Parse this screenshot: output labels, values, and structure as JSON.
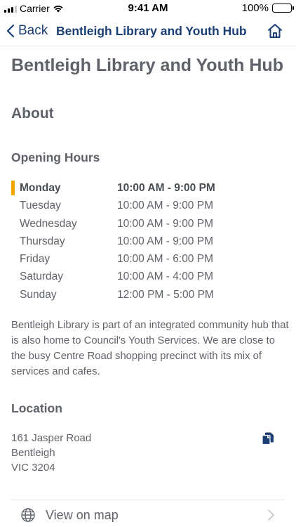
{
  "status_bar": {
    "carrier": "Carrier",
    "time": "9:41 AM",
    "battery": "100%"
  },
  "nav": {
    "back_label": "Back",
    "title": "Bentleigh Library and Youth Hub",
    "back_icon": "chevron-left-icon",
    "home_icon": "home-icon"
  },
  "page": {
    "title": "Bentleigh Library and Youth Hub"
  },
  "about": {
    "heading": "About",
    "opening_hours_heading": "Opening Hours",
    "hours": [
      {
        "day": "Monday",
        "time": "10:00 AM - 9:00 PM",
        "today": true
      },
      {
        "day": "Tuesday",
        "time": "10:00 AM - 9:00 PM",
        "today": false
      },
      {
        "day": "Wednesday",
        "time": "10:00 AM - 9:00 PM",
        "today": false
      },
      {
        "day": "Thursday",
        "time": "10:00 AM - 9:00 PM",
        "today": false
      },
      {
        "day": "Friday",
        "time": "10:00 AM - 6:00 PM",
        "today": false
      },
      {
        "day": "Saturday",
        "time": "10:00 AM - 4:00 PM",
        "today": false
      },
      {
        "day": "Sunday",
        "time": "12:00 PM - 5:00 PM",
        "today": false
      }
    ],
    "description": "Bentleigh Library is part of an integrated community hub that is also home to Council's Youth Services. We are close to the busy Centre Road shopping precinct with its mix of services and cafes."
  },
  "location": {
    "heading": "Location",
    "address_line1": "161 Jasper Road",
    "address_line2": "Bentleigh",
    "address_line3": "VIC 3204",
    "copy_icon": "copy-icon",
    "map_link_label": "View on map",
    "map_icon": "globe-icon",
    "chevron_icon": "chevron-right-icon"
  },
  "colors": {
    "accent": "#1b3e73",
    "today_marker": "#f0a500",
    "text": "#5f6369"
  }
}
